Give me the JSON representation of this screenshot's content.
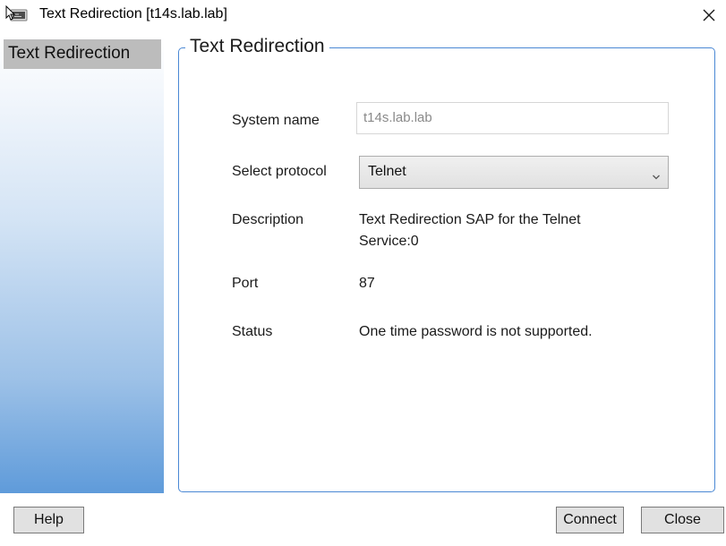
{
  "window": {
    "title": "Text Redirection [t14s.lab.lab]"
  },
  "titlebar": {
    "app_icon": "terminal-app-icon",
    "close_icon": "close-x-icon"
  },
  "sidebar": {
    "items": [
      {
        "label": "Text Redirection",
        "selected": true
      }
    ]
  },
  "group": {
    "title": "Text Redirection",
    "border_color": "#4a88d4"
  },
  "form": {
    "system_name": {
      "label": "System name",
      "value": "t14s.lab.lab",
      "disabled": true
    },
    "protocol": {
      "label": "Select protocol",
      "value": "Telnet",
      "icon": "chevron-down-icon"
    },
    "description": {
      "label": "Description",
      "line1": "Text Redirection SAP for the Telnet",
      "line2": "Service:0"
    },
    "port": {
      "label": "Port",
      "value": "87"
    },
    "status": {
      "label": "Status",
      "value": "One time password is not supported."
    }
  },
  "buttons": {
    "help": "Help",
    "connect": "Connect",
    "close": "Close"
  }
}
